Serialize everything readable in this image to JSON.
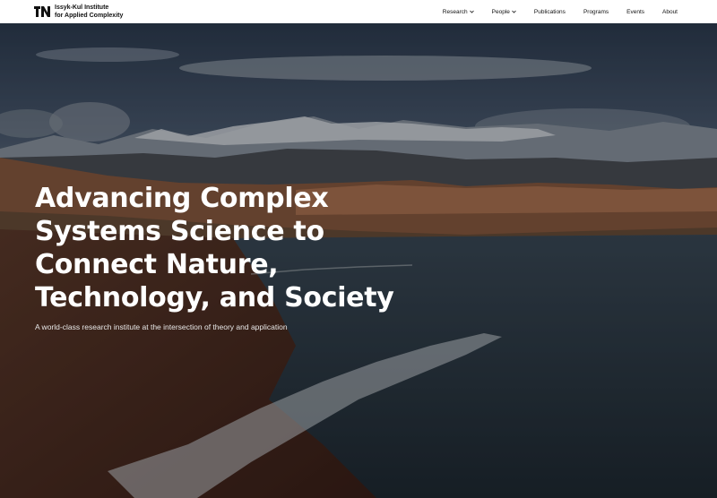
{
  "brand": {
    "line1": "Issyk-Kul Institute",
    "line2": "for Applied Complexity",
    "logo_icon": "institute-logo-icon"
  },
  "nav": {
    "items": [
      {
        "label": "Research",
        "has_dropdown": true
      },
      {
        "label": "People",
        "has_dropdown": true
      },
      {
        "label": "Publications",
        "has_dropdown": false
      },
      {
        "label": "Programs",
        "has_dropdown": false
      },
      {
        "label": "Events",
        "has_dropdown": false
      },
      {
        "label": "About",
        "has_dropdown": false
      }
    ]
  },
  "hero": {
    "headline_lines": [
      "Advancing Complex",
      "Systems Science to",
      "Connect Nature,",
      "Technology, and Society"
    ],
    "subtitle": "A world-class research institute at the intersection of theory and application",
    "background": "lake-shore-mountains-photo"
  },
  "colors": {
    "nav_bg": "#ffffff",
    "nav_text": "#111111",
    "hero_text": "#ffffff"
  }
}
